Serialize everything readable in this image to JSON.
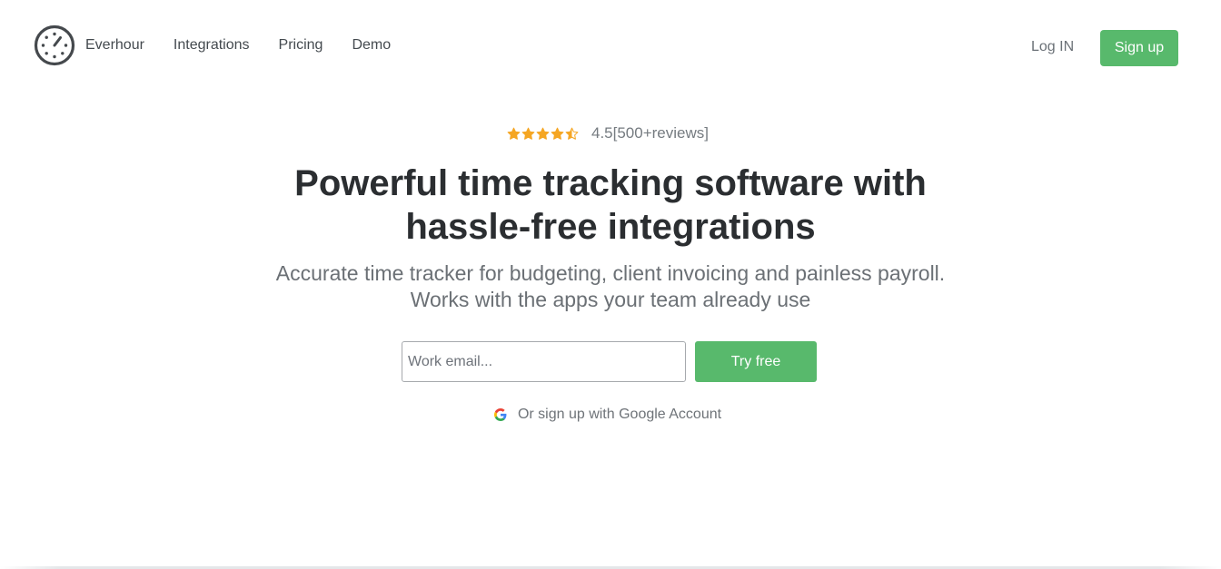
{
  "header": {
    "logo_icon": "clock-icon",
    "nav": [
      {
        "label": "Everhour"
      },
      {
        "label": "Integrations"
      },
      {
        "label": "Pricing"
      },
      {
        "label": "Demo"
      }
    ],
    "login_label": "Log IN",
    "signup_label": "Sign up"
  },
  "hero": {
    "rating": {
      "stars": 4.5,
      "stars_max": 5,
      "text": "4.5[500+reviews]"
    },
    "headline_line1": "Powerful time tracking software with",
    "headline_line2": "hassle-free integrations",
    "subline_line1": "Accurate time tracker for budgeting, client invoicing and painless payroll.",
    "subline_line2": "Works with the apps your team already use",
    "email_placeholder": "Work email...",
    "email_value": "",
    "try_label": "Try free",
    "google_label": "Or sign up with Google Account"
  },
  "colors": {
    "accent": "#58b96c",
    "star": "#f5a623",
    "headline": "#2b2e31",
    "muted": "#6b7075"
  }
}
